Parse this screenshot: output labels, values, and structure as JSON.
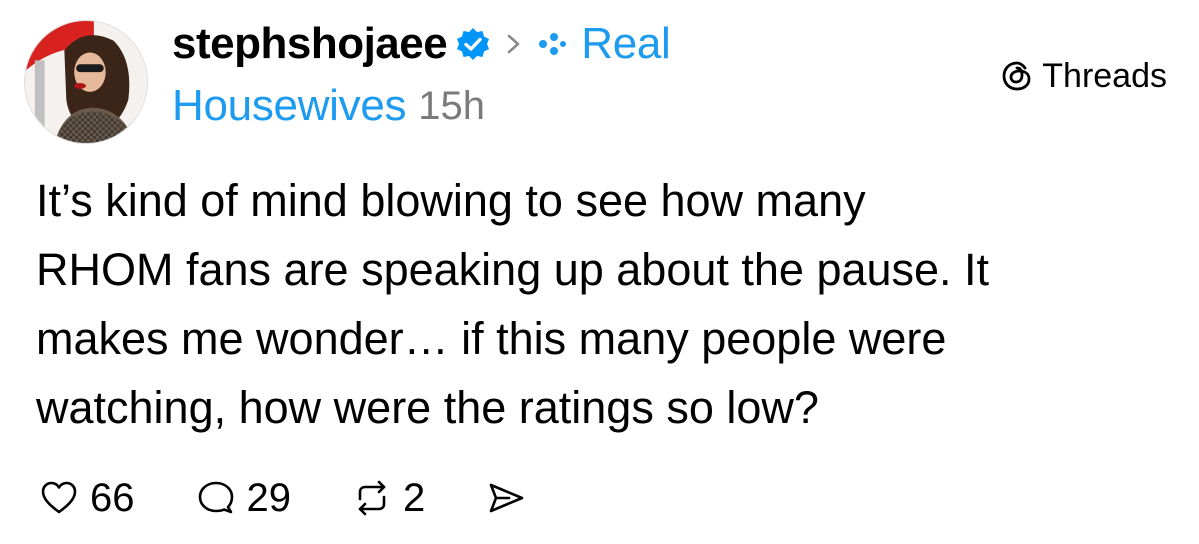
{
  "post": {
    "username": "stephshojaee",
    "community_line1": "Real",
    "community_line2": "Housewives",
    "time": "15h",
    "body_lines": [
      "It’s kind of mind blowing to see how many",
      "RHOM fans are speaking up about the pause. It",
      "makes me wonder… if this many people were",
      "watching, how were the ratings so low?"
    ]
  },
  "brand": {
    "label": "Threads"
  },
  "actions": {
    "likes": "66",
    "replies": "29",
    "reposts": "2"
  },
  "icons": {
    "verified": "verified-badge-icon",
    "chevron": "chevron-right-icon",
    "community": "community-dots-icon",
    "brand": "threads-logo-icon",
    "like": "heart-icon",
    "reply": "comment-bubble-icon",
    "repost": "repost-icon",
    "share": "send-icon"
  },
  "colors": {
    "accent": "#1d9bf0",
    "muted": "#7a7a7a",
    "text": "#000000",
    "background": "#ffffff"
  }
}
